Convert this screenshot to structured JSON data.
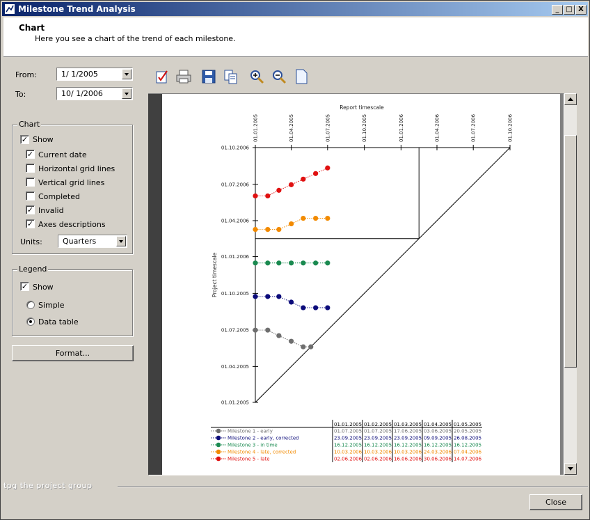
{
  "window": {
    "title": "Milestone Trend Analysis",
    "controls": [
      "_",
      "□",
      "X"
    ]
  },
  "header": {
    "title": "Chart",
    "subtitle": "Here you see a chart of the trend of each milestone."
  },
  "dates": {
    "from_label": "From:",
    "from_value": "1/  1/2005",
    "to_label": "To:",
    "to_value": "10/  1/2006"
  },
  "chart_group": {
    "title": "Chart",
    "show": "Show",
    "options": [
      {
        "label": "Current date",
        "checked": true
      },
      {
        "label": "Horizontal grid lines",
        "checked": false
      },
      {
        "label": "Vertical grid lines",
        "checked": false
      },
      {
        "label": "Completed",
        "checked": false
      },
      {
        "label": "Invalid",
        "checked": true
      },
      {
        "label": "Axes descriptions",
        "checked": true
      }
    ],
    "units_label": "Units:",
    "units_value": "Quarters"
  },
  "legend_group": {
    "title": "Legend",
    "show": "Show",
    "simple": "Simple",
    "data_table": "Data table"
  },
  "format_button": "Format...",
  "toolbar": {
    "icons": [
      "properties-icon",
      "print-icon",
      "save-icon",
      "copy-icon",
      "zoom-in-icon",
      "zoom-out-icon",
      "page-icon"
    ]
  },
  "brand": "tpg  the project group",
  "close_button": "Close",
  "chart_data": {
    "type": "line",
    "xlabel": "Report timescale",
    "ylabel": "Project timescale",
    "x_ticks": [
      "01.01.2005",
      "01.04.2005",
      "01.07.2005",
      "01.10.2005",
      "01.01.2006",
      "01.04.2006",
      "01.07.2006",
      "01.10.2006"
    ],
    "y_ticks": [
      "01.01.2005",
      "01.04.2005",
      "01.07.2005",
      "01.10.2005",
      "01.01.2006",
      "01.04.2006",
      "01.07.2006",
      "01.10.2006"
    ],
    "colors": {
      "Milestone 1 - early": "#6e6e6e",
      "Milestone 2 - early, corrected": "#0b0b7a",
      "Milestone 3 - in time": "#1a8a50",
      "Milestone 4 - late, corrected": "#f28a00",
      "Milestone 5 - late": "#e01010"
    },
    "series": [
      {
        "name": "Milestone 1 - early",
        "points": [
          [
            "2005-01-01",
            "2005-07-01"
          ],
          [
            "2005-02-01",
            "2005-07-01"
          ],
          [
            "2005-03-01",
            "2005-06-17"
          ],
          [
            "2005-04-01",
            "2005-06-03"
          ],
          [
            "2005-05-01",
            "2005-05-20"
          ],
          [
            "2005-05-20",
            "2005-05-20"
          ]
        ]
      },
      {
        "name": "Milestone 2 - early, corrected",
        "points": [
          [
            "2005-01-01",
            "2005-09-23"
          ],
          [
            "2005-02-01",
            "2005-09-23"
          ],
          [
            "2005-03-01",
            "2005-09-23"
          ],
          [
            "2005-04-01",
            "2005-09-09"
          ],
          [
            "2005-05-01",
            "2005-08-26"
          ],
          [
            "2005-06-01",
            "2005-08-26"
          ],
          [
            "2005-07-01",
            "2005-08-26"
          ]
        ]
      },
      {
        "name": "Milestone 3 - in time",
        "points": [
          [
            "2005-01-01",
            "2005-12-16"
          ],
          [
            "2005-02-01",
            "2005-12-16"
          ],
          [
            "2005-03-01",
            "2005-12-16"
          ],
          [
            "2005-04-01",
            "2005-12-16"
          ],
          [
            "2005-05-01",
            "2005-12-16"
          ],
          [
            "2005-06-01",
            "2005-12-16"
          ],
          [
            "2005-07-01",
            "2005-12-16"
          ]
        ]
      },
      {
        "name": "Milestone 4 - late, corrected",
        "points": [
          [
            "2005-01-01",
            "2006-03-10"
          ],
          [
            "2005-02-01",
            "2006-03-10"
          ],
          [
            "2005-03-01",
            "2006-03-10"
          ],
          [
            "2005-04-01",
            "2006-03-24"
          ],
          [
            "2005-05-01",
            "2006-04-07"
          ],
          [
            "2005-06-01",
            "2006-04-07"
          ],
          [
            "2005-07-01",
            "2006-04-07"
          ]
        ]
      },
      {
        "name": "Milestone 5 - late",
        "points": [
          [
            "2005-01-01",
            "2006-06-02"
          ],
          [
            "2005-02-01",
            "2006-06-02"
          ],
          [
            "2005-03-01",
            "2006-06-16"
          ],
          [
            "2005-04-01",
            "2006-06-30"
          ],
          [
            "2005-05-01",
            "2006-07-14"
          ],
          [
            "2005-06-01",
            "2006-07-28"
          ],
          [
            "2005-07-01",
            "2006-08-11"
          ]
        ]
      }
    ],
    "current_date": "2006-02-15",
    "table": {
      "columns": [
        "01.01.2005",
        "01.02.2005",
        "01.03.2005",
        "01.04.2005",
        "01.05.2005"
      ],
      "rows": [
        {
          "name": "Milestone 1 - early",
          "values": [
            "01.07.2005",
            "01.07.2005",
            "17.06.2005",
            "03.06.2005",
            "20.05.2005"
          ]
        },
        {
          "name": "Milestone 2 - early, corrected",
          "values": [
            "23.09.2005",
            "23.09.2005",
            "23.09.2005",
            "09.09.2005",
            "26.08.2005"
          ]
        },
        {
          "name": "Milestone 3 - in time",
          "values": [
            "16.12.2005",
            "16.12.2005",
            "16.12.2005",
            "16.12.2005",
            "16.12.2005"
          ]
        },
        {
          "name": "Milestone 4 - late, corrected",
          "values": [
            "10.03.2006",
            "10.03.2006",
            "10.03.2006",
            "24.03.2006",
            "07.04.2006"
          ]
        },
        {
          "name": "Milestone 5 - late",
          "values": [
            "02.06.2006",
            "02.06.2006",
            "16.06.2006",
            "30.06.2006",
            "14.07.2006"
          ]
        }
      ]
    }
  }
}
